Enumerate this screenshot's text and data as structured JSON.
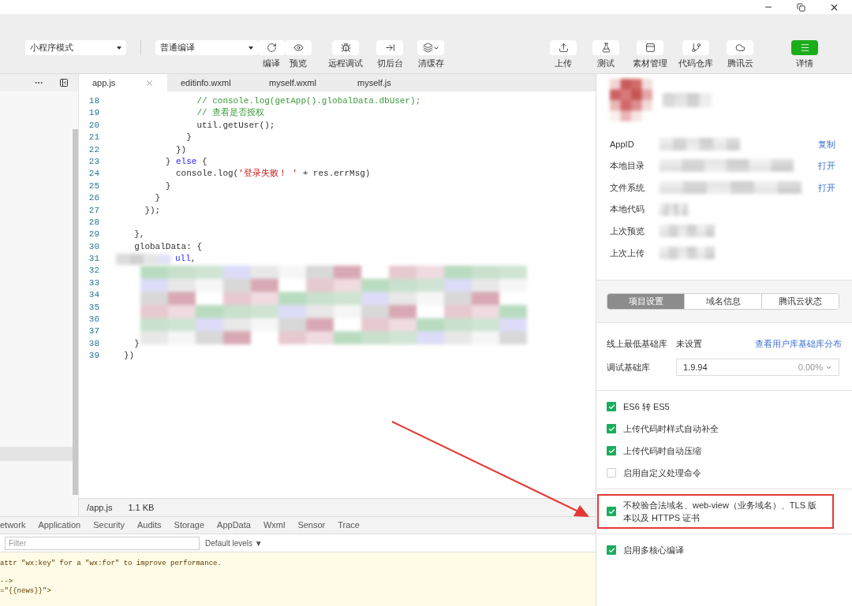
{
  "toolbar": {
    "mode_select": "小程序模式",
    "compile_select": "普通编译",
    "left_tools": [
      {
        "label": "编译",
        "caret": false
      },
      {
        "label": "预览",
        "caret": false
      },
      {
        "label": "远程调试",
        "caret": false
      },
      {
        "label": "切后台",
        "caret": false
      },
      {
        "label": "清缓存",
        "caret": true
      }
    ],
    "right_tools": [
      {
        "label": "上传",
        "primary": false
      },
      {
        "label": "测试",
        "primary": false
      },
      {
        "label": "素材管理",
        "primary": false
      },
      {
        "label": "代码仓库",
        "primary": false
      },
      {
        "label": "腾讯云",
        "primary": false
      },
      {
        "label": "详情",
        "primary": true
      }
    ]
  },
  "editor": {
    "tabs": [
      {
        "label": "app.js",
        "selected": true
      },
      {
        "label": "editinfo.wxml",
        "selected": false
      },
      {
        "label": "myself.wxml",
        "selected": false
      },
      {
        "label": "myself.js",
        "selected": false
      }
    ],
    "lines": [
      {
        "number": "18",
        "segments": [
          {
            "kind": "comment",
            "text": "              // console.log(getApp().globalData.dbUser);"
          }
        ]
      },
      {
        "number": "19",
        "segments": [
          {
            "kind": "comment",
            "text": "              // 查看是否授权"
          }
        ]
      },
      {
        "number": "20",
        "segments": [
          {
            "kind": "plain",
            "text": "              util.getUser();"
          }
        ]
      },
      {
        "number": "21",
        "segments": [
          {
            "kind": "plain",
            "text": "            }"
          }
        ]
      },
      {
        "number": "22",
        "segments": [
          {
            "kind": "plain",
            "text": "          })"
          }
        ]
      },
      {
        "number": "23",
        "segments": [
          {
            "kind": "plain",
            "text": "        } "
          },
          {
            "kind": "keyword",
            "text": "else"
          },
          {
            "kind": "plain",
            "text": " {"
          }
        ]
      },
      {
        "number": "24",
        "segments": [
          {
            "kind": "plain",
            "text": "          console.log("
          },
          {
            "kind": "string",
            "text": "'登录失败！ '"
          },
          {
            "kind": "plain",
            "text": " + res.errMsg)"
          }
        ]
      },
      {
        "number": "25",
        "segments": [
          {
            "kind": "plain",
            "text": "        }"
          }
        ]
      },
      {
        "number": "26",
        "segments": [
          {
            "kind": "plain",
            "text": "      }"
          }
        ]
      },
      {
        "number": "27",
        "segments": [
          {
            "kind": "plain",
            "text": "    });"
          }
        ]
      },
      {
        "number": "28"
      },
      {
        "number": "29",
        "segments": [
          {
            "kind": "plain",
            "text": "  },"
          }
        ]
      },
      {
        "number": "30",
        "segments": [
          {
            "kind": "plain",
            "text": "  globalData: {"
          }
        ]
      },
      {
        "number": "31",
        "redacted": true,
        "segments": [
          {
            "kind": "keyword",
            "text": "ull"
          },
          {
            "kind": "plain",
            "text": ","
          }
        ]
      },
      {
        "number": "32"
      },
      {
        "number": "33"
      },
      {
        "number": "34"
      },
      {
        "number": "35"
      },
      {
        "number": "36"
      },
      {
        "number": "37"
      },
      {
        "number": "38",
        "segments": [
          {
            "kind": "plain",
            "text": "  }"
          }
        ]
      },
      {
        "number": "39",
        "segments": [
          {
            "kind": "plain",
            "text": "})"
          }
        ]
      }
    ],
    "status": {
      "path": "/app.js",
      "size": "1.1 KB"
    }
  },
  "devtools": {
    "tabs": [
      "etwork",
      "Application",
      "Security",
      "Audits",
      "Storage",
      "AppData",
      "Wxml",
      "Sensor",
      "Trace"
    ],
    "filter": {
      "placeholder": "Filter"
    },
    "levels": "Default levels ▼",
    "console_lines": [
      "attr \"wx:key\" for a \"wx:for\" to improve performance.",
      "-->",
      "=\"{{news}}\">"
    ]
  },
  "details": {
    "info_rows": [
      {
        "label": "AppID",
        "action": "复制"
      },
      {
        "label": "本地目录",
        "action": "打开"
      },
      {
        "label": "文件系统",
        "action": "打开"
      },
      {
        "label": "本地代码"
      },
      {
        "label": "上次预览"
      },
      {
        "label": "上次上传"
      }
    ],
    "segments": [
      {
        "label": "项目设置",
        "selected": true
      },
      {
        "label": "域名信息",
        "selected": false
      },
      {
        "label": "腾讯云状态",
        "selected": false
      }
    ],
    "min_library": {
      "label": "线上最低基础库",
      "value": "未设置",
      "link": "查看用户库基础库分布"
    },
    "debug_library": {
      "label": "调试基础库",
      "value": "1.9.94",
      "share": "0.00%"
    },
    "option_groups": [
      [
        {
          "label": "ES6 转 ES5",
          "checked": true,
          "highlighted": false
        },
        {
          "label": "上传代码时样式自动补全",
          "checked": true,
          "highlighted": false
        },
        {
          "label": "上传代码时自动压缩",
          "checked": true,
          "highlighted": false
        },
        {
          "label": "启用自定义处理命令",
          "checked": false,
          "highlighted": false
        }
      ],
      [
        {
          "label": "不校验合法域名、web-view（业务域名）、TLS 版本以及 HTTPS 证书",
          "checked": true,
          "highlighted": true
        }
      ],
      [
        {
          "label": "启用多核心编译",
          "checked": true,
          "highlighted": false
        }
      ]
    ]
  },
  "annotation": {
    "kind": "arrow"
  }
}
